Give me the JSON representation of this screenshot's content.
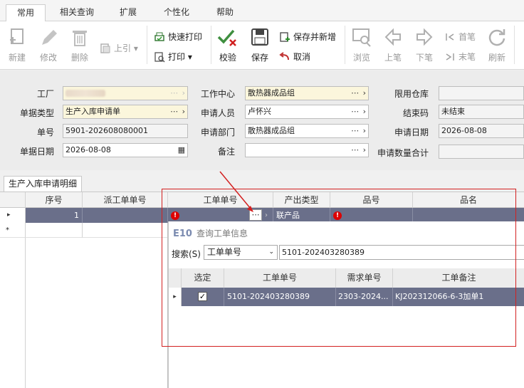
{
  "ribbon": {
    "tabs": [
      "常用",
      "相关查询",
      "扩展",
      "个性化",
      "帮助"
    ],
    "active_tab": "常用"
  },
  "toolbar": {
    "new": "新建",
    "edit": "修改",
    "delete": "删除",
    "pull": "上引",
    "quick_print": "快速打印",
    "print": "打印",
    "verify": "校验",
    "save": "保存",
    "save_new": "保存并新增",
    "cancel": "取消",
    "browse": "浏览",
    "prev": "上笔",
    "next": "下笔",
    "first": "首笔",
    "last": "末笔",
    "refresh": "刷新"
  },
  "form": {
    "factory_label": "工厂",
    "doc_type_label": "单据类型",
    "doc_type_value": "生产入库申请单",
    "doc_no_label": "单号",
    "doc_no_value": "5901-202608080001",
    "doc_date_label": "单据日期",
    "doc_date_value": "2026-08-08",
    "work_center_label": "工作中心",
    "work_center_value": "散热器成品组",
    "applicant_label": "申请人员",
    "applicant_value": "卢怀兴",
    "dept_label": "申请部门",
    "dept_value": "散热器成品组",
    "remark_label": "备注",
    "remark_value": "",
    "warehouse_label": "限用仓库",
    "warehouse_value": "",
    "close_code_label": "结束码",
    "close_code_value": "未结束",
    "apply_date_label": "申请日期",
    "apply_date_value": "2026-08-08",
    "qty_total_label": "申请数量合计",
    "qty_total_value": ""
  },
  "detail": {
    "tab_label": "生产入库申请明细",
    "columns": [
      "序号",
      "派工单单号",
      "工单单号",
      "产出类型",
      "品号",
      "品名"
    ],
    "rows": [
      {
        "seq": "1",
        "dispatch_no": "",
        "wo_no": "",
        "output_type": "联产品",
        "item_no": "",
        "item_name": ""
      }
    ],
    "new_row_marker": "*"
  },
  "popup": {
    "logo": "E10",
    "title": "查询工单信息",
    "search_label": "搜索(S)",
    "search_field": "工单单号",
    "search_value": "5101-202403280389",
    "columns": [
      "选定",
      "工单单号",
      "需求单号",
      "工单备注"
    ],
    "rows": [
      {
        "selected": "✓",
        "wo_no": "5101-202403280389",
        "demand_no": "2303-2024...",
        "remark": "KJ202312066-6-3加单1"
      }
    ]
  },
  "icons": [
    "new-icon",
    "edit-icon",
    "delete-icon",
    "pull-icon",
    "quick-print-icon",
    "print-icon",
    "verify-icon",
    "save-icon",
    "save-new-icon",
    "cancel-icon",
    "browse-icon",
    "prev-icon",
    "next-icon",
    "first-icon",
    "last-icon",
    "refresh-icon"
  ],
  "colors": {
    "selected_row": "#6a6f8a",
    "required_field": "#fbf6dc",
    "highlight_box": "#d32020",
    "error": "#dd0000"
  }
}
